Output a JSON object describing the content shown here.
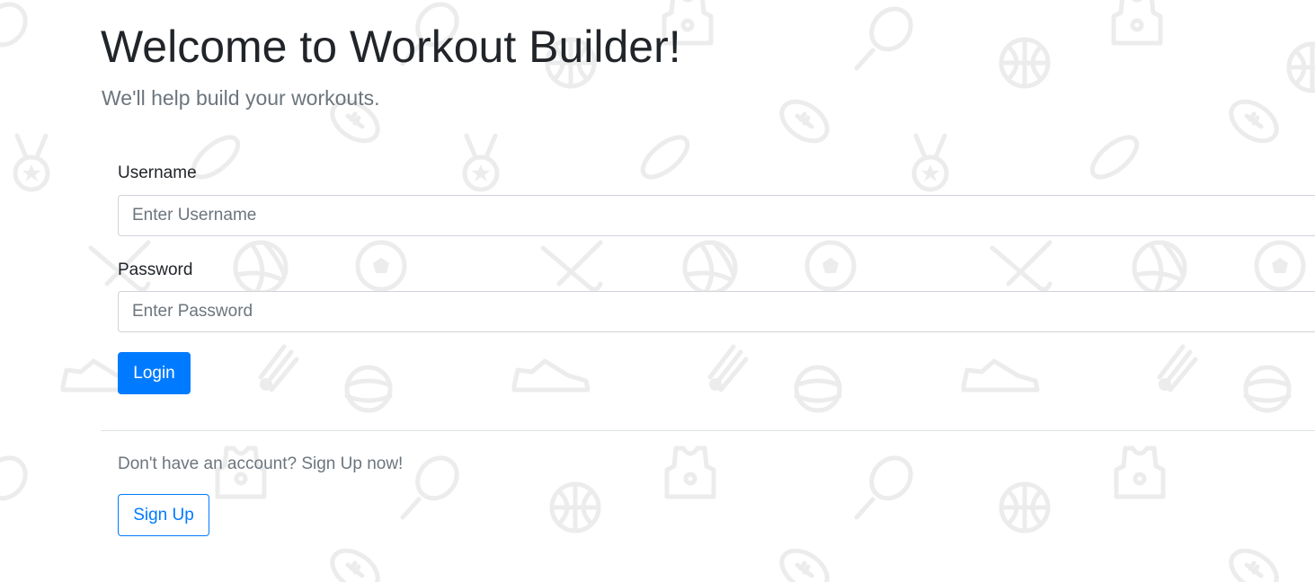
{
  "header": {
    "title": "Welcome to Workout Builder!",
    "subtitle": "We'll help build your workouts."
  },
  "login_form": {
    "username_label": "Username",
    "username_placeholder": "Enter Username",
    "username_value": "",
    "password_label": "Password",
    "password_placeholder": "Enter Password",
    "password_value": "",
    "login_button_label": "Login"
  },
  "signup": {
    "prompt": "Don't have an account? Sign Up now!",
    "button_label": "Sign Up"
  },
  "background_icons": [
    "tennis-racket-icon",
    "basketball-icon",
    "football-icon",
    "medal-icon",
    "hockey-puck-icon",
    "volleyball-icon",
    "soccer-ball-icon",
    "hockey-stick-icon",
    "sneaker-icon",
    "shuttlecock-icon",
    "tennis-ball-icon",
    "jersey-icon"
  ],
  "colors": {
    "primary": "#007bff",
    "text": "#212529",
    "muted": "#6c757d",
    "input_border": "#ced4da",
    "pattern": "#ececec"
  }
}
